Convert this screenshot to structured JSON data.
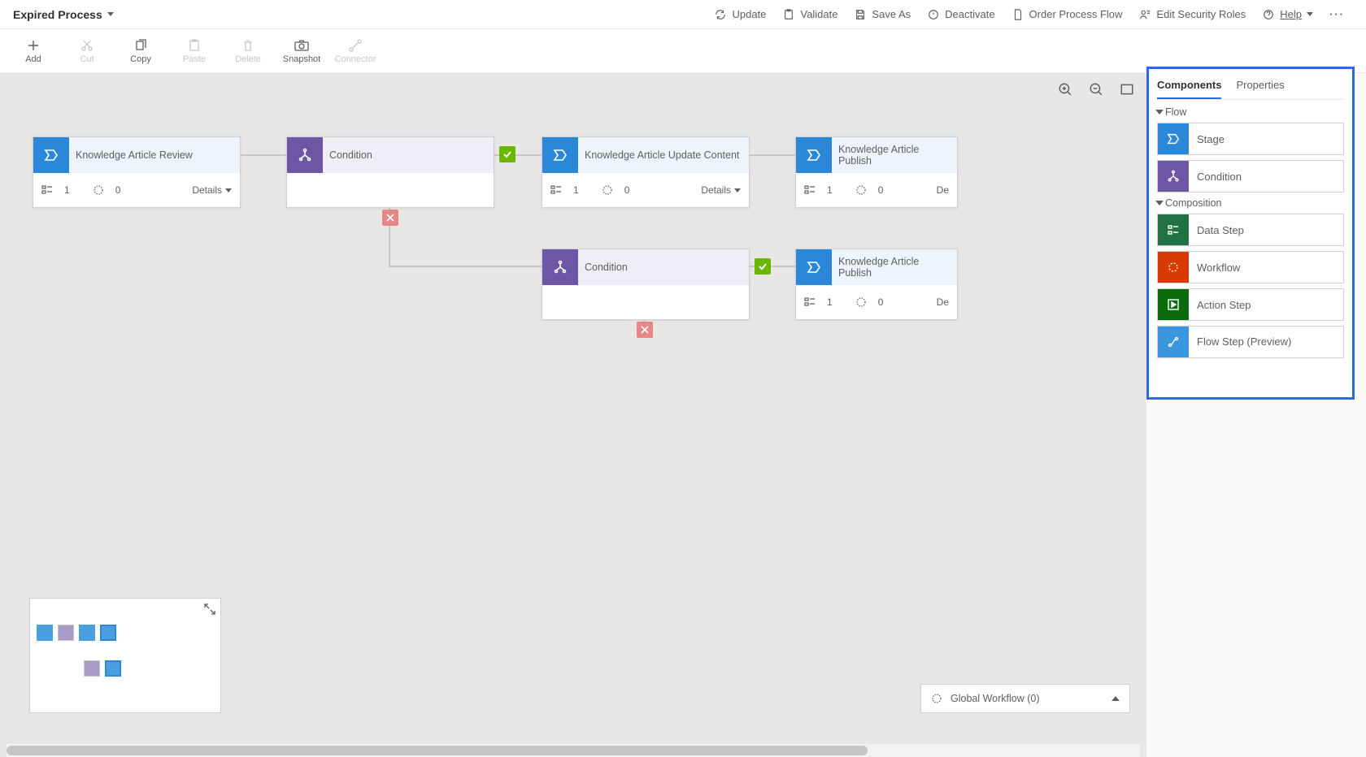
{
  "header": {
    "title": "Expired Process",
    "actions": {
      "update": "Update",
      "validate": "Validate",
      "save_as": "Save As",
      "deactivate": "Deactivate",
      "order": "Order Process Flow",
      "edit_security": "Edit Security Roles",
      "help": "Help"
    }
  },
  "toolbar": {
    "add": "Add",
    "cut": "Cut",
    "copy": "Copy",
    "paste": "Paste",
    "delete": "Delete",
    "snapshot": "Snapshot",
    "connector": "Connector"
  },
  "nodes": {
    "n1": {
      "title": "Knowledge Article Review",
      "steps": "1",
      "wf": "0",
      "details": "Details"
    },
    "n2": {
      "title": "Condition"
    },
    "n3": {
      "title": "Knowledge Article Update Content",
      "steps": "1",
      "wf": "0",
      "details": "Details"
    },
    "n4": {
      "title": "Knowledge Article Publish",
      "steps": "1",
      "wf": "0",
      "details": "De"
    },
    "n5": {
      "title": "Condition"
    },
    "n6": {
      "title": "Knowledge Article Publish",
      "steps": "1",
      "wf": "0",
      "details": "De"
    }
  },
  "global_workflow": "Global Workflow (0)",
  "sidepanel": {
    "tab_components": "Components",
    "tab_properties": "Properties",
    "section_flow": "Flow",
    "section_composition": "Composition",
    "items": {
      "stage": "Stage",
      "condition": "Condition",
      "data_step": "Data Step",
      "workflow": "Workflow",
      "action_step": "Action Step",
      "flow_step": "Flow Step (Preview)"
    }
  }
}
